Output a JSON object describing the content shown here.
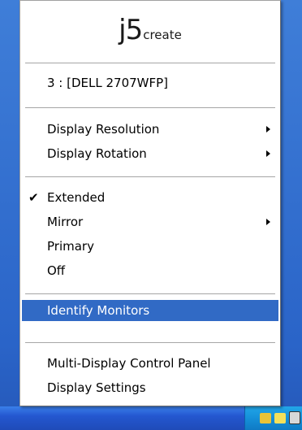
{
  "logo": {
    "brand": "j5",
    "suffix": "create"
  },
  "menu": {
    "device": "3 : [DELL 2707WFP]",
    "items": [
      {
        "label": "Display Resolution",
        "submenu": true
      },
      {
        "label": "Display Rotation",
        "submenu": true
      },
      {
        "label": "Extended",
        "checked": true
      },
      {
        "label": "Mirror",
        "submenu": true
      },
      {
        "label": "Primary"
      },
      {
        "label": "Off"
      },
      {
        "label": "Identify Monitors",
        "highlighted": true
      },
      {
        "label": "Multi-Display Control Panel"
      },
      {
        "label": "Display Settings"
      }
    ],
    "check_glyph": "✔"
  },
  "colors": {
    "highlight": "#316ac5",
    "menu_bg": "#ffffff",
    "taskbar": "#2457d0"
  },
  "tray": {
    "icons": [
      "display-tray-icon",
      "network-tray-icon",
      "monitor-tray-icon"
    ]
  }
}
